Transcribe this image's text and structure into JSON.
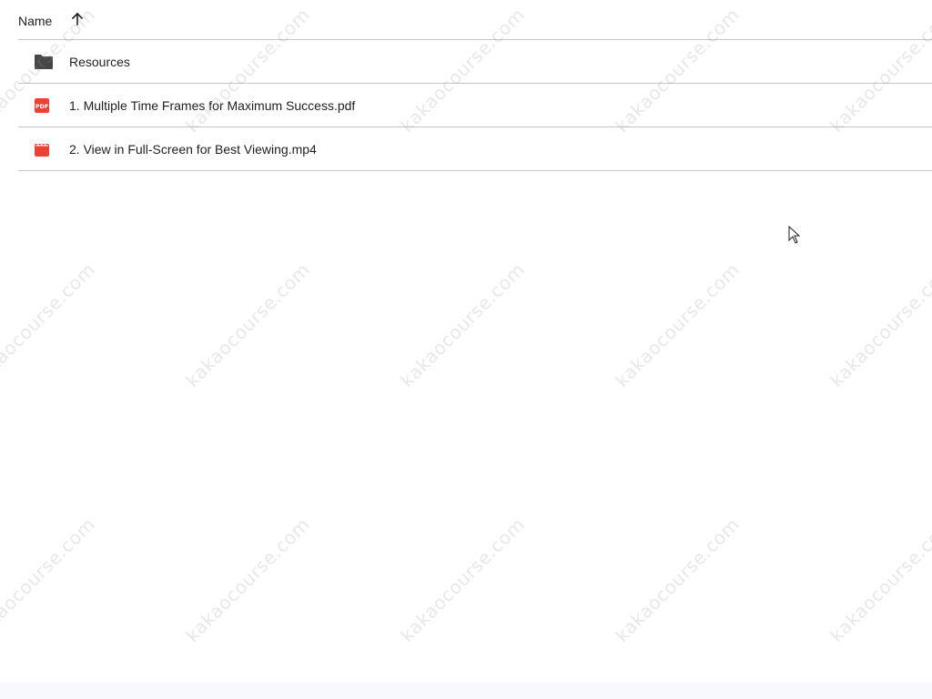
{
  "header": {
    "name_label": "Name",
    "sort_icon": "arrow-upward-icon"
  },
  "rows": [
    {
      "name": "Resources",
      "icon": "folder-icon"
    },
    {
      "name": "1. Multiple Time Frames for Maximum Success.pdf",
      "icon": "pdf-icon",
      "icon_text": "PDF"
    },
    {
      "name": "2. View in Full-Screen for Best Viewing.mp4",
      "icon": "video-icon"
    }
  ],
  "watermark": "kakaocourse.com",
  "colors": {
    "folder": "#444746",
    "pdf": "#ea4335",
    "video": "#ea4335",
    "divider": "#c4c7c5"
  }
}
